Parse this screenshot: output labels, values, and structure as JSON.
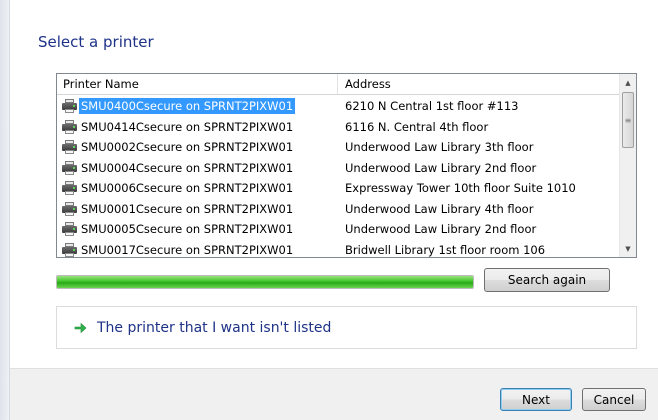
{
  "page": {
    "title": "Select a printer"
  },
  "printer_list": {
    "columns": [
      "Printer Name",
      "Address"
    ],
    "rows": [
      {
        "name": "SMU0400Csecure on SPRNT2PIXW01",
        "address": "6210 N Central 1st floor #113",
        "selected": true
      },
      {
        "name": "SMU0414Csecure on SPRNT2PIXW01",
        "address": "6116 N. Central  4th floor",
        "selected": false
      },
      {
        "name": "SMU0002Csecure on SPRNT2PIXW01",
        "address": "Underwood Law Library 3th floor",
        "selected": false
      },
      {
        "name": "SMU0004Csecure on SPRNT2PIXW01",
        "address": "Underwood Law Library 2nd floor",
        "selected": false
      },
      {
        "name": "SMU0006Csecure on SPRNT2PIXW01",
        "address": "Expressway Tower 10th floor Suite 1010",
        "selected": false
      },
      {
        "name": "SMU0001Csecure on SPRNT2PIXW01",
        "address": "Underwood Law Library 4th floor",
        "selected": false
      },
      {
        "name": "SMU0005Csecure on SPRNT2PIXW01",
        "address": "Underwood Law Library 2nd floor",
        "selected": false
      },
      {
        "name": "SMU0017Csecure on SPRNT2PIXW01",
        "address": "Bridwell Library 1st floor room 106",
        "selected": false
      }
    ]
  },
  "search": {
    "progress_fraction": 1.0,
    "search_again_label": "Search again"
  },
  "not_listed": {
    "label": "The printer that I want isn't listed"
  },
  "footer": {
    "next_label": "Next",
    "cancel_label": "Cancel"
  },
  "colors": {
    "heading_blue": "#1e3287",
    "selection_blue": "#3399ff",
    "progress_green": "#3fc52a"
  },
  "icons": {
    "printer": "printer-icon",
    "arrow": "green-arrow-icon"
  }
}
